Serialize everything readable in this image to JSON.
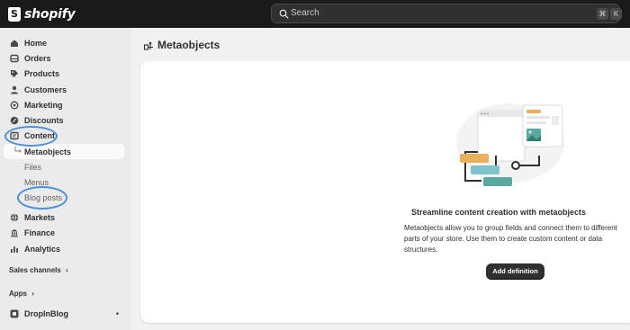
{
  "topbar": {
    "logo_text": "shopify",
    "search_placeholder": "Search",
    "shortcut_keys": [
      "⌘",
      "K"
    ]
  },
  "sidebar": {
    "items": [
      {
        "label": "Home",
        "icon": "home-icon"
      },
      {
        "label": "Orders",
        "icon": "orders-icon"
      },
      {
        "label": "Products",
        "icon": "tag-icon"
      },
      {
        "label": "Customers",
        "icon": "person-icon"
      },
      {
        "label": "Marketing",
        "icon": "target-icon"
      },
      {
        "label": "Discounts",
        "icon": "discount-icon"
      },
      {
        "label": "Content",
        "icon": "content-icon"
      },
      {
        "label": "Metaobjects",
        "icon": "arrow-subdirectory-icon"
      },
      {
        "label": "Markets",
        "icon": "globe-icon"
      },
      {
        "label": "Finance",
        "icon": "bank-icon"
      },
      {
        "label": "Analytics",
        "icon": "bar-chart-icon"
      }
    ],
    "sub_items": [
      "Files",
      "Menus",
      "Blog posts"
    ],
    "sales_channels_label": "Sales channels",
    "apps_label": "Apps",
    "app_item": {
      "label": "DropInBlog",
      "dot": "•"
    }
  },
  "main": {
    "page_title": "Metaobjects",
    "empty_state": {
      "title": "Streamline content creation with metaobjects",
      "description": "Metaobjects allow you to group fields and connect them to different parts of your store. Use them to create custom content or data structures.",
      "button_label": "Add definition"
    }
  },
  "colors": {
    "topbar": "#1a1a1a",
    "sidebar": "#ebebeb",
    "annotation_circle": "#4a90d9",
    "primary_button": "#303030"
  }
}
